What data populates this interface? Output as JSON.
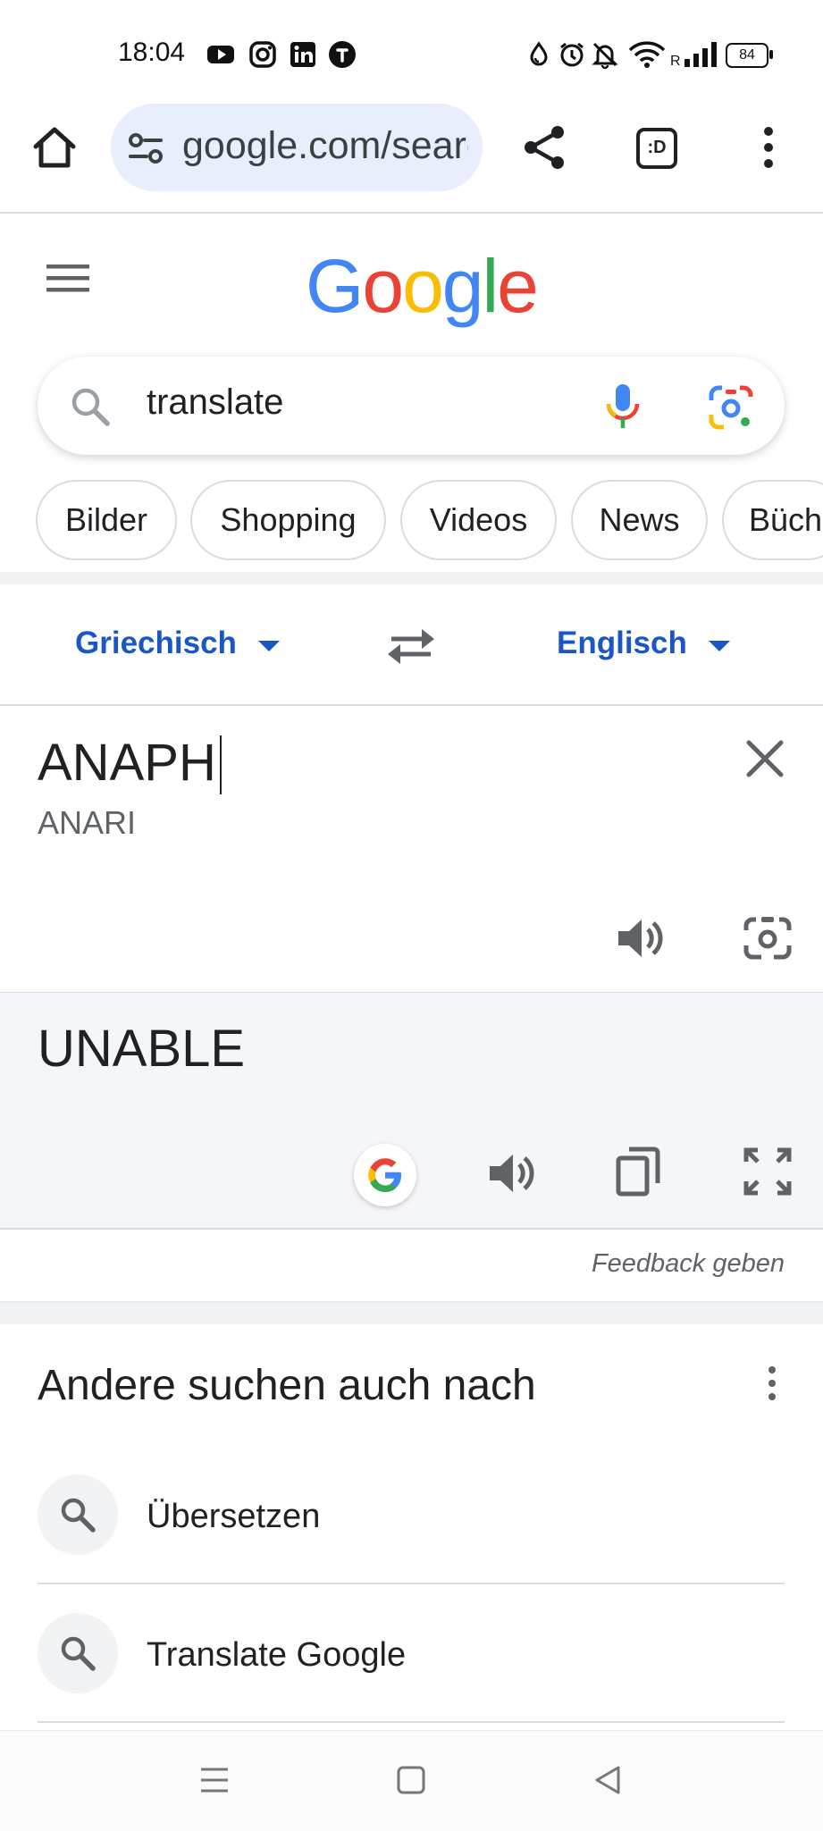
{
  "status_bar": {
    "time": "18:04",
    "battery": "84",
    "app_icons": [
      "youtube-icon",
      "instagram-icon",
      "linkedin-icon",
      "threads-icon"
    ],
    "right_icons": [
      "water-drop-icon",
      "alarm-icon",
      "silent-bell-icon",
      "wifi-icon",
      "signal-icon"
    ],
    "signal_label": "R"
  },
  "browser": {
    "url": "google.com/search",
    "tab_switcher_label": ":D"
  },
  "google": {
    "logo_letters": [
      "G",
      "o",
      "o",
      "g",
      "l",
      "e"
    ],
    "logo_colors": [
      "#4285F4",
      "#EA4335",
      "#FBBC05",
      "#4285F4",
      "#34A853",
      "#EA4335"
    ]
  },
  "search": {
    "query": "translate"
  },
  "chips": [
    "Bilder",
    "Shopping",
    "Videos",
    "News",
    "Büch"
  ],
  "translate": {
    "source_lang": "Griechisch",
    "target_lang": "Englisch",
    "source_text": "ANAPH",
    "transliteration": "ANARI",
    "result_text": "UNABLE",
    "feedback": "Feedback geben"
  },
  "related": {
    "title": "Andere suchen auch nach",
    "items": [
      "Übersetzen",
      "Translate Google"
    ]
  },
  "colors": {
    "accent_blue": "#1a56c8",
    "url_pill_bg": "#e8eefc",
    "result_bg": "#f5f6f9"
  }
}
